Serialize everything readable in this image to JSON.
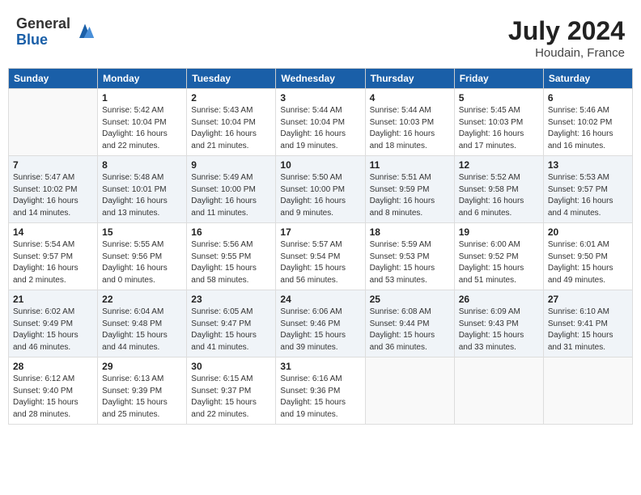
{
  "header": {
    "logo_general": "General",
    "logo_blue": "Blue",
    "month_year": "July 2024",
    "location": "Houdain, France"
  },
  "weekdays": [
    "Sunday",
    "Monday",
    "Tuesday",
    "Wednesday",
    "Thursday",
    "Friday",
    "Saturday"
  ],
  "weeks": [
    [
      {
        "day": "",
        "info": ""
      },
      {
        "day": "1",
        "info": "Sunrise: 5:42 AM\nSunset: 10:04 PM\nDaylight: 16 hours\nand 22 minutes."
      },
      {
        "day": "2",
        "info": "Sunrise: 5:43 AM\nSunset: 10:04 PM\nDaylight: 16 hours\nand 21 minutes."
      },
      {
        "day": "3",
        "info": "Sunrise: 5:44 AM\nSunset: 10:04 PM\nDaylight: 16 hours\nand 19 minutes."
      },
      {
        "day": "4",
        "info": "Sunrise: 5:44 AM\nSunset: 10:03 PM\nDaylight: 16 hours\nand 18 minutes."
      },
      {
        "day": "5",
        "info": "Sunrise: 5:45 AM\nSunset: 10:03 PM\nDaylight: 16 hours\nand 17 minutes."
      },
      {
        "day": "6",
        "info": "Sunrise: 5:46 AM\nSunset: 10:02 PM\nDaylight: 16 hours\nand 16 minutes."
      }
    ],
    [
      {
        "day": "7",
        "info": "Sunrise: 5:47 AM\nSunset: 10:02 PM\nDaylight: 16 hours\nand 14 minutes."
      },
      {
        "day": "8",
        "info": "Sunrise: 5:48 AM\nSunset: 10:01 PM\nDaylight: 16 hours\nand 13 minutes."
      },
      {
        "day": "9",
        "info": "Sunrise: 5:49 AM\nSunset: 10:00 PM\nDaylight: 16 hours\nand 11 minutes."
      },
      {
        "day": "10",
        "info": "Sunrise: 5:50 AM\nSunset: 10:00 PM\nDaylight: 16 hours\nand 9 minutes."
      },
      {
        "day": "11",
        "info": "Sunrise: 5:51 AM\nSunset: 9:59 PM\nDaylight: 16 hours\nand 8 minutes."
      },
      {
        "day": "12",
        "info": "Sunrise: 5:52 AM\nSunset: 9:58 PM\nDaylight: 16 hours\nand 6 minutes."
      },
      {
        "day": "13",
        "info": "Sunrise: 5:53 AM\nSunset: 9:57 PM\nDaylight: 16 hours\nand 4 minutes."
      }
    ],
    [
      {
        "day": "14",
        "info": "Sunrise: 5:54 AM\nSunset: 9:57 PM\nDaylight: 16 hours\nand 2 minutes."
      },
      {
        "day": "15",
        "info": "Sunrise: 5:55 AM\nSunset: 9:56 PM\nDaylight: 16 hours\nand 0 minutes."
      },
      {
        "day": "16",
        "info": "Sunrise: 5:56 AM\nSunset: 9:55 PM\nDaylight: 15 hours\nand 58 minutes."
      },
      {
        "day": "17",
        "info": "Sunrise: 5:57 AM\nSunset: 9:54 PM\nDaylight: 15 hours\nand 56 minutes."
      },
      {
        "day": "18",
        "info": "Sunrise: 5:59 AM\nSunset: 9:53 PM\nDaylight: 15 hours\nand 53 minutes."
      },
      {
        "day": "19",
        "info": "Sunrise: 6:00 AM\nSunset: 9:52 PM\nDaylight: 15 hours\nand 51 minutes."
      },
      {
        "day": "20",
        "info": "Sunrise: 6:01 AM\nSunset: 9:50 PM\nDaylight: 15 hours\nand 49 minutes."
      }
    ],
    [
      {
        "day": "21",
        "info": "Sunrise: 6:02 AM\nSunset: 9:49 PM\nDaylight: 15 hours\nand 46 minutes."
      },
      {
        "day": "22",
        "info": "Sunrise: 6:04 AM\nSunset: 9:48 PM\nDaylight: 15 hours\nand 44 minutes."
      },
      {
        "day": "23",
        "info": "Sunrise: 6:05 AM\nSunset: 9:47 PM\nDaylight: 15 hours\nand 41 minutes."
      },
      {
        "day": "24",
        "info": "Sunrise: 6:06 AM\nSunset: 9:46 PM\nDaylight: 15 hours\nand 39 minutes."
      },
      {
        "day": "25",
        "info": "Sunrise: 6:08 AM\nSunset: 9:44 PM\nDaylight: 15 hours\nand 36 minutes."
      },
      {
        "day": "26",
        "info": "Sunrise: 6:09 AM\nSunset: 9:43 PM\nDaylight: 15 hours\nand 33 minutes."
      },
      {
        "day": "27",
        "info": "Sunrise: 6:10 AM\nSunset: 9:41 PM\nDaylight: 15 hours\nand 31 minutes."
      }
    ],
    [
      {
        "day": "28",
        "info": "Sunrise: 6:12 AM\nSunset: 9:40 PM\nDaylight: 15 hours\nand 28 minutes."
      },
      {
        "day": "29",
        "info": "Sunrise: 6:13 AM\nSunset: 9:39 PM\nDaylight: 15 hours\nand 25 minutes."
      },
      {
        "day": "30",
        "info": "Sunrise: 6:15 AM\nSunset: 9:37 PM\nDaylight: 15 hours\nand 22 minutes."
      },
      {
        "day": "31",
        "info": "Sunrise: 6:16 AM\nSunset: 9:36 PM\nDaylight: 15 hours\nand 19 minutes."
      },
      {
        "day": "",
        "info": ""
      },
      {
        "day": "",
        "info": ""
      },
      {
        "day": "",
        "info": ""
      }
    ]
  ]
}
